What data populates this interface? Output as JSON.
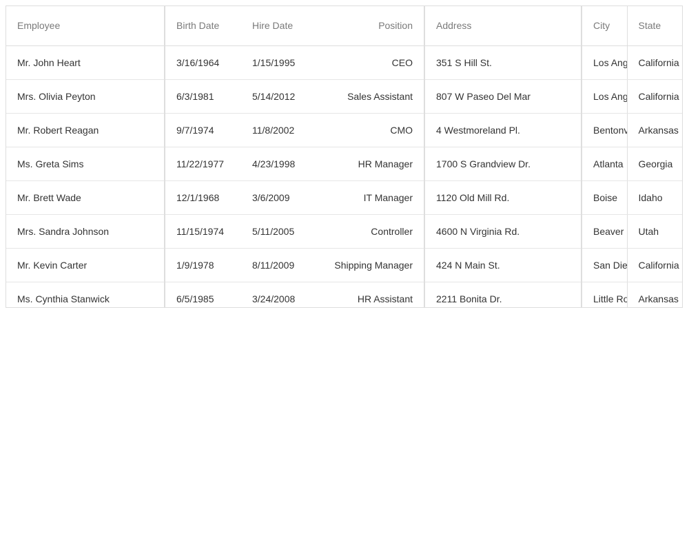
{
  "grid": {
    "columns": {
      "employee": "Employee",
      "birth_date": "Birth Date",
      "hire_date": "Hire Date",
      "position": "Position",
      "address": "Address",
      "city": "City",
      "state": "State"
    },
    "rows": [
      {
        "employee": "Mr. John Heart",
        "birth_date": "3/16/1964",
        "hire_date": "1/15/1995",
        "position": "CEO",
        "address": "351 S Hill St.",
        "city": "Los Angeles",
        "state": "California"
      },
      {
        "employee": "Mrs. Olivia Peyton",
        "birth_date": "6/3/1981",
        "hire_date": "5/14/2012",
        "position": "Sales Assistant",
        "address": "807 W Paseo Del Mar",
        "city": "Los Angeles",
        "state": "California"
      },
      {
        "employee": "Mr. Robert Reagan",
        "birth_date": "9/7/1974",
        "hire_date": "11/8/2002",
        "position": "CMO",
        "address": "4 Westmoreland Pl.",
        "city": "Bentonville",
        "state": "Arkansas"
      },
      {
        "employee": "Ms. Greta Sims",
        "birth_date": "11/22/1977",
        "hire_date": "4/23/1998",
        "position": "HR Manager",
        "address": "1700 S Grandview Dr.",
        "city": "Atlanta",
        "state": "Georgia"
      },
      {
        "employee": "Mr. Brett Wade",
        "birth_date": "12/1/1968",
        "hire_date": "3/6/2009",
        "position": "IT Manager",
        "address": "1120 Old Mill Rd.",
        "city": "Boise",
        "state": "Idaho"
      },
      {
        "employee": "Mrs. Sandra Johnson",
        "birth_date": "11/15/1974",
        "hire_date": "5/11/2005",
        "position": "Controller",
        "address": "4600 N Virginia Rd.",
        "city": "Beaver",
        "state": "Utah"
      },
      {
        "employee": "Mr. Kevin Carter",
        "birth_date": "1/9/1978",
        "hire_date": "8/11/2009",
        "position": "Shipping Manager",
        "address": "424 N Main St.",
        "city": "San Diego",
        "state": "California"
      },
      {
        "employee": "Ms. Cynthia Stanwick",
        "birth_date": "6/5/1985",
        "hire_date": "3/24/2008",
        "position": "HR Assistant",
        "address": "2211 Bonita Dr.",
        "city": "Little Rock",
        "state": "Arkansas"
      }
    ]
  }
}
